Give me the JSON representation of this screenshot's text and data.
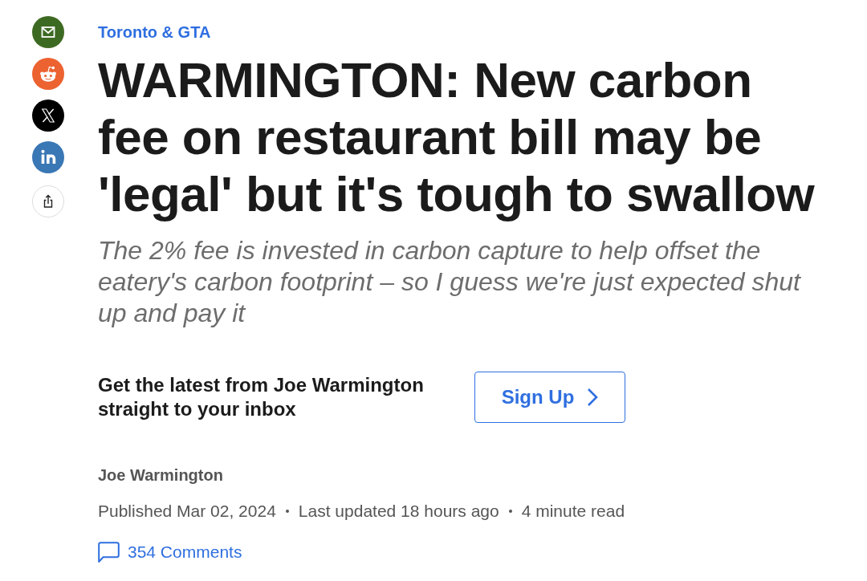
{
  "article": {
    "category": "Toronto & GTA",
    "headline": "WARMINGTON: New carbon fee on restaurant bill may be 'legal' but it's tough to swallow",
    "subheadline": "The 2% fee is invested in carbon capture to help offset the eatery's carbon footprint – so I guess we're just expected shut up and pay it",
    "newsletter": {
      "prompt": "Get the latest from Joe Warmington straight to your inbox",
      "button": "Sign Up"
    },
    "author": "Joe Warmington",
    "meta": [
      "Published Mar 02, 2024",
      "Last updated 18 hours ago",
      "4 minute read"
    ],
    "comments": "354 Comments"
  }
}
